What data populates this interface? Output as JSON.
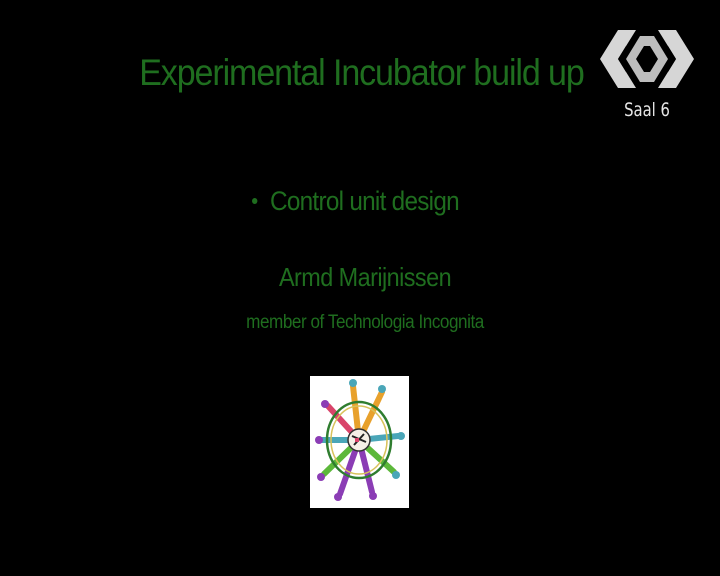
{
  "slide": {
    "title": "Experimental Incubator build up",
    "bullets": [
      {
        "text": "Control unit design"
      }
    ],
    "speaker": {
      "name": "Armd Marijnissen",
      "affiliation": "member of Technologia Incognita"
    },
    "logo_icon": "technologia-incognita-wheel-logo"
  },
  "overlay": {
    "channel_logo_icon": "ccc-diamond-logo",
    "channel_label": "Saal 6"
  },
  "colors": {
    "background": "#000000",
    "slide_text": "#1f6e1f",
    "overlay_text": "#e6e6e6"
  }
}
